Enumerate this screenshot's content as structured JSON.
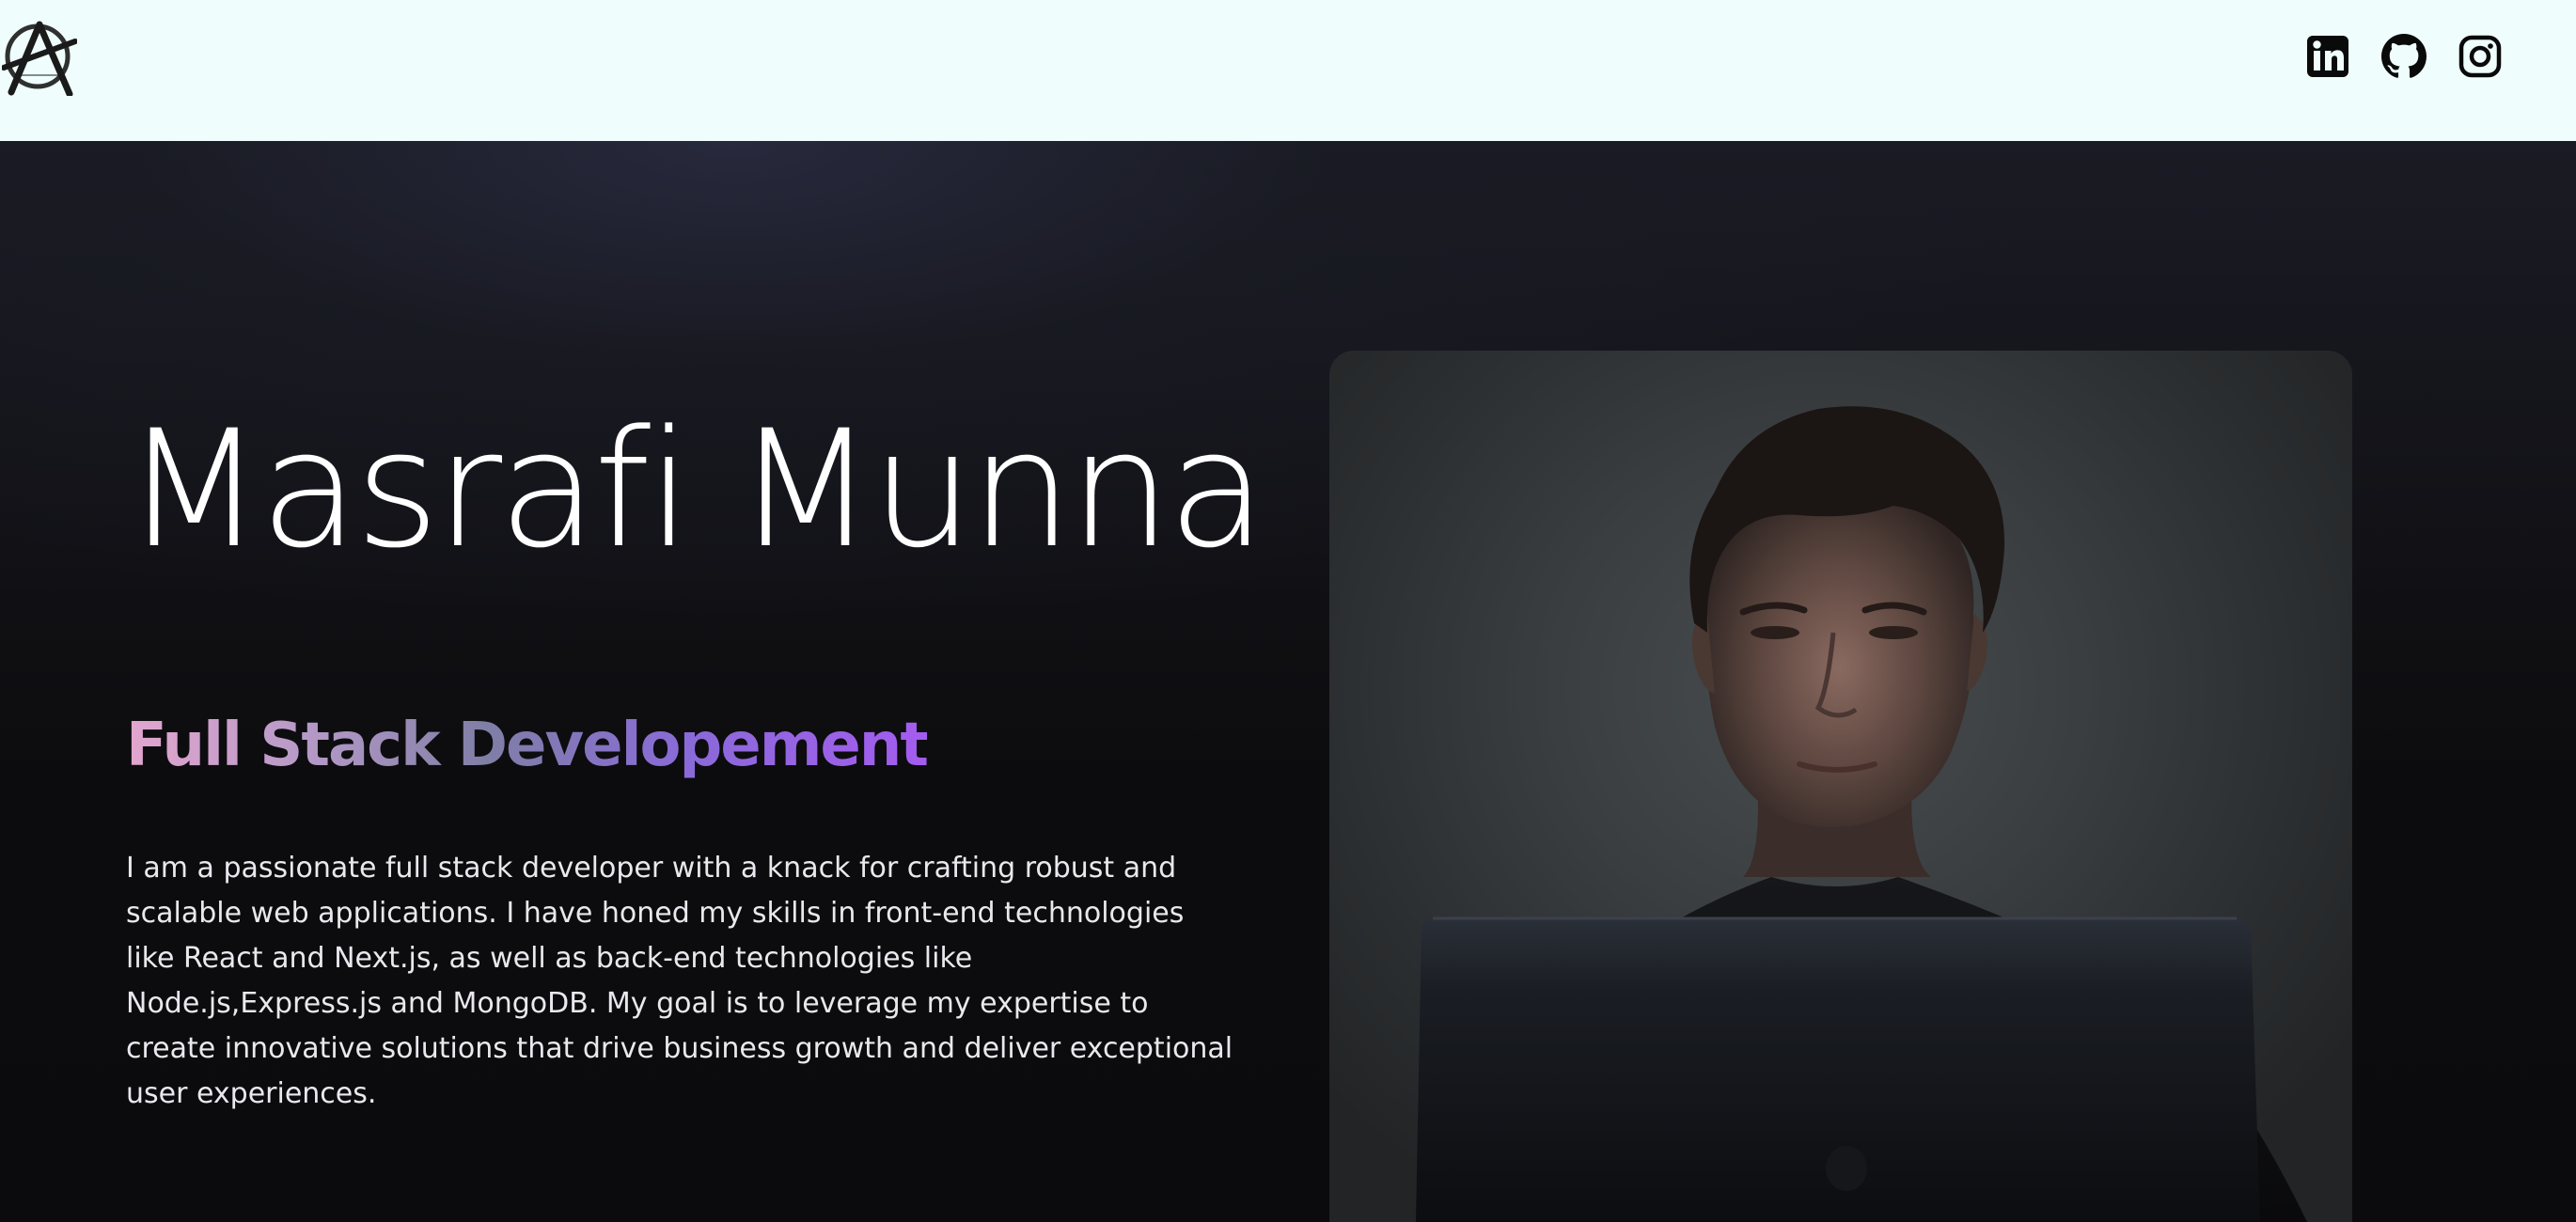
{
  "header": {
    "logo_icon": "anarchy-a-logo-icon",
    "social_links": [
      {
        "name": "linkedin",
        "icon": "linkedin-icon"
      },
      {
        "name": "github",
        "icon": "github-icon"
      },
      {
        "name": "instagram",
        "icon": "instagram-icon"
      }
    ]
  },
  "hero": {
    "name": "Masrafi Munna",
    "role": "Full Stack Developement",
    "bio": "I am a passionate full stack developer with a knack for crafting robust and scalable web applications. I have honed my skills in front-end technologies like React and Next.js, as well as back-end technologies like Node.js,Express.js and MongoDB. My goal is to leverage my expertise to create innovative solutions that drive business growth and deliver exceptional user experiences.",
    "portrait": "portrait-photo"
  },
  "colors": {
    "header_bg": "#effdfd",
    "hero_bg": "#0b0b0d",
    "role_gradient_start": "#e3a6cf",
    "role_gradient_end": "#a45cf0"
  }
}
